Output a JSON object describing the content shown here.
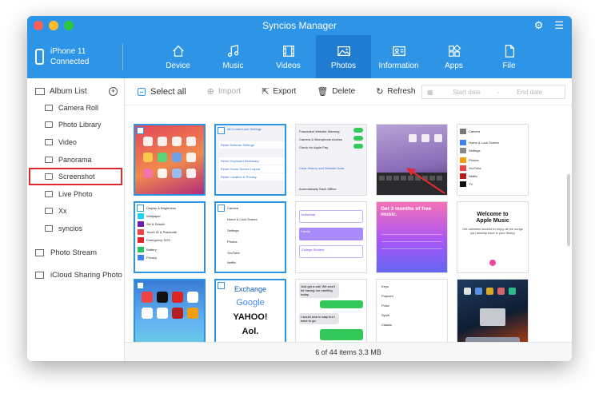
{
  "window": {
    "title": "Syncios Manager"
  },
  "device": {
    "name": "iPhone 11",
    "status": "Connected"
  },
  "nav": [
    {
      "label": "Device",
      "icon": "home-icon"
    },
    {
      "label": "Music",
      "icon": "music-note-icon"
    },
    {
      "label": "Videos",
      "icon": "film-icon"
    },
    {
      "label": "Photos",
      "icon": "image-icon",
      "active": true
    },
    {
      "label": "Information",
      "icon": "contact-card-icon"
    },
    {
      "label": "Apps",
      "icon": "apps-icon"
    },
    {
      "label": "File",
      "icon": "folder-icon"
    }
  ],
  "sidebar": {
    "album_list_label": "Album List",
    "albums": [
      {
        "label": "Camera Roll"
      },
      {
        "label": "Photo Library"
      },
      {
        "label": "Video"
      },
      {
        "label": "Panorama"
      },
      {
        "label": "Screenshot",
        "selected": true
      },
      {
        "label": "Live Photo"
      },
      {
        "label": "Xx"
      },
      {
        "label": "syncios"
      }
    ],
    "photo_stream": "Photo Stream",
    "icloud_sharing": "iCloud Sharing Photo"
  },
  "toolbar": {
    "select_all": "Select all",
    "import": "Import",
    "export": "Export",
    "delete": "Delete",
    "refresh": "Refresh",
    "start_date": "Start date",
    "date_sep": "-",
    "end_date": "End date"
  },
  "status": {
    "summary": "6 of 44 items 3.3 MB"
  },
  "thumbnails": [
    {
      "kind": "ios-home",
      "selected": true
    },
    {
      "kind": "settings-reset",
      "selected": true
    },
    {
      "kind": "settings-safari",
      "selected": false
    },
    {
      "kind": "ios-home-purple",
      "selected": false
    },
    {
      "kind": "settings-list",
      "selected": false
    },
    {
      "kind": "settings-general",
      "selected": true
    },
    {
      "kind": "settings-privacy",
      "selected": true
    },
    {
      "kind": "music-plans",
      "selected": false
    },
    {
      "kind": "apple-music-promo",
      "selected": false
    },
    {
      "kind": "welcome-apple-music",
      "selected": false
    },
    {
      "kind": "ios-home-dark",
      "selected": true
    },
    {
      "kind": "search-engines",
      "selected": true
    },
    {
      "kind": "messages",
      "selected": false
    },
    {
      "kind": "sound-list",
      "selected": false
    },
    {
      "kind": "ipad-home",
      "selected": false
    }
  ],
  "thumb_text": {
    "reset_all": "All Content and Settings",
    "reset_net": "Reset Network Settings",
    "reset_kbd": "Reset Keyboard Dictionary",
    "reset_home": "Reset Home Screen Layout",
    "reset_loc": "Reset Location & Privacy",
    "safari_fraud": "Fraudulent Website Warning",
    "safari_cam": "Camera & Microphone Access",
    "safari_pay": "Check for Apple Pay",
    "safari_clear": "Clear History and Website Data",
    "safari_offline": "Automatically Save Offline",
    "display": "Display & Brightness",
    "wallpaper": "Wallpaper",
    "siri": "Siri & Search",
    "touchid": "Touch ID & Passcode",
    "sos": "Emergency SOS",
    "battery": "Battery",
    "privacy": "Privacy",
    "camera": "Camera",
    "homelock": "Home & Lock Screen",
    "settings": "Settings",
    "photos": "Photos",
    "youtube": "YouTube",
    "netflix": "Netflix",
    "tv": "TV",
    "individual": "Individual",
    "family": "Family",
    "college": "College Student",
    "promo": "Get 3 months of free music.",
    "welcome1": "Welcome to",
    "welcome2": "Apple Music",
    "welcome_sub": "Get unlimited access to enjoy all the songs you already have in your library",
    "exchange": "Exchange",
    "google": "Google",
    "yahoo": "YAHOO!",
    "aol": "Aol.",
    "msg1": "Just got a call. We won't be having our meeting today.",
    "msg2": "I would love to stay but I have to go",
    "keys": "Keys",
    "popcorn": "Popcorn",
    "pulse": "Pulse",
    "synth": "Synth",
    "classic": "Classic"
  },
  "colors": {
    "accent": "#2e94e6",
    "highlight": "#e0282e"
  }
}
